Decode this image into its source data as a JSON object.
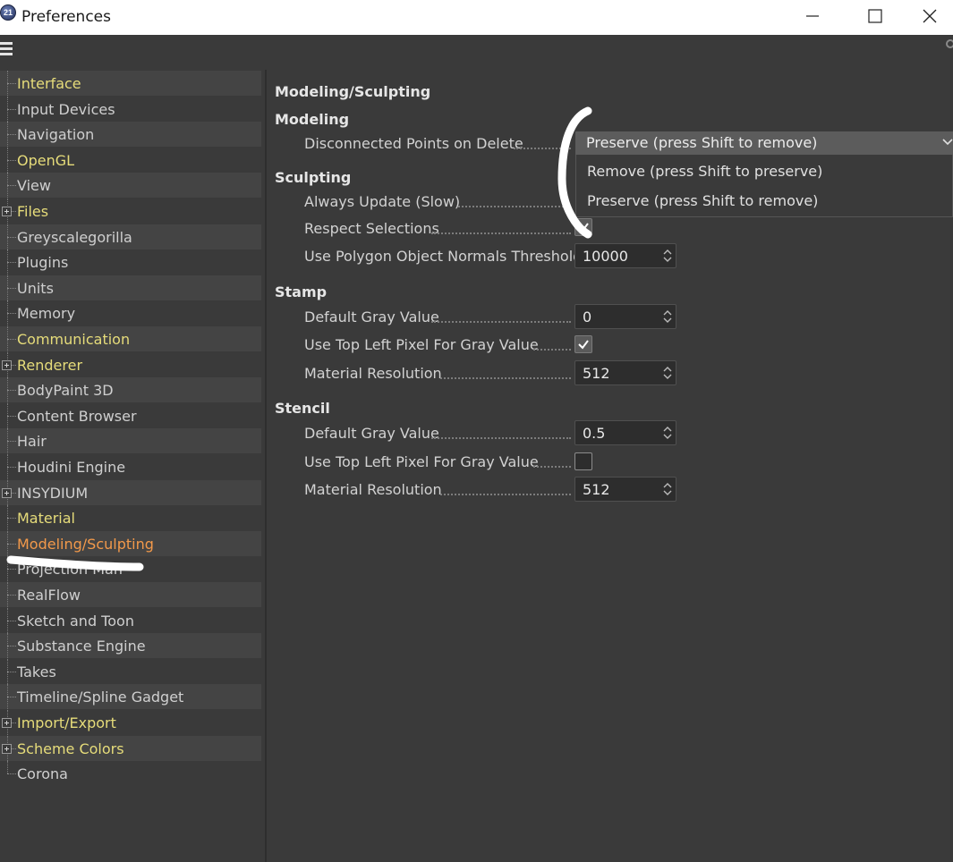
{
  "window": {
    "title": "Preferences",
    "icon_text": "21"
  },
  "sidebar": {
    "items": [
      {
        "label": "Interface",
        "color": "yellow",
        "expandable": false
      },
      {
        "label": "Input Devices",
        "color": "normal",
        "expandable": false
      },
      {
        "label": "Navigation",
        "color": "normal",
        "expandable": false
      },
      {
        "label": "OpenGL",
        "color": "yellow",
        "expandable": false
      },
      {
        "label": "View",
        "color": "normal",
        "expandable": false
      },
      {
        "label": "Files",
        "color": "yellow",
        "expandable": true
      },
      {
        "label": "Greyscalegorilla",
        "color": "normal",
        "expandable": false
      },
      {
        "label": "Plugins",
        "color": "normal",
        "expandable": false
      },
      {
        "label": "Units",
        "color": "normal",
        "expandable": false
      },
      {
        "label": "Memory",
        "color": "normal",
        "expandable": false
      },
      {
        "label": "Communication",
        "color": "yellow",
        "expandable": false
      },
      {
        "label": "Renderer",
        "color": "yellow",
        "expandable": true
      },
      {
        "label": "BodyPaint 3D",
        "color": "normal",
        "expandable": false
      },
      {
        "label": "Content Browser",
        "color": "normal",
        "expandable": false
      },
      {
        "label": "Hair",
        "color": "normal",
        "expandable": false
      },
      {
        "label": "Houdini Engine",
        "color": "normal",
        "expandable": false
      },
      {
        "label": "INSYDIUM",
        "color": "normal",
        "expandable": true
      },
      {
        "label": "Material",
        "color": "yellow",
        "expandable": false
      },
      {
        "label": "Modeling/Sculpting",
        "color": "active",
        "expandable": false
      },
      {
        "label": "Projection Man",
        "color": "normal",
        "expandable": false
      },
      {
        "label": "RealFlow",
        "color": "normal",
        "expandable": false
      },
      {
        "label": "Sketch and Toon",
        "color": "normal",
        "expandable": false
      },
      {
        "label": "Substance Engine",
        "color": "normal",
        "expandable": false
      },
      {
        "label": "Takes",
        "color": "normal",
        "expandable": false
      },
      {
        "label": "Timeline/Spline Gadget",
        "color": "normal",
        "expandable": false
      },
      {
        "label": "Import/Export",
        "color": "yellow",
        "expandable": true
      },
      {
        "label": "Scheme Colors",
        "color": "yellow",
        "expandable": true
      },
      {
        "label": "Corona",
        "color": "normal",
        "expandable": false
      }
    ]
  },
  "content": {
    "page_title": "Modeling/Sculpting",
    "modeling": {
      "title": "Modeling",
      "disconnected_label": "Disconnected Points on Delete",
      "disconnected_value": "Preserve (press Shift to remove)",
      "options": [
        "Remove (press Shift to preserve)",
        "Preserve (press Shift to remove)"
      ]
    },
    "sculpting": {
      "title": "Sculpting",
      "always_update_label": "Always Update (Slow)",
      "respect_selections_label": "Respect Selections",
      "respect_selections_checked": true,
      "normals_threshold_label": "Use Polygon Object Normals Threshold",
      "normals_threshold_value": "10000"
    },
    "stamp": {
      "title": "Stamp",
      "gray_label": "Default Gray Value",
      "gray_value": "0",
      "topleft_label": "Use Top Left Pixel For Gray Value",
      "topleft_checked": true,
      "resolution_label": "Material Resolution",
      "resolution_value": "512"
    },
    "stencil": {
      "title": "Stencil",
      "gray_label": "Default Gray Value",
      "gray_value": "0.5",
      "topleft_label": "Use Top Left Pixel For Gray Value",
      "topleft_checked": false,
      "resolution_label": "Material Resolution",
      "resolution_value": "512"
    }
  },
  "colors": {
    "background": "#3a3a3a",
    "stripe": "#444444",
    "yellow_text": "#e6dc7a",
    "active_text": "#f2994a",
    "normal_text": "#cfcfcf",
    "dropdown_bg": "#5c5c5c"
  }
}
